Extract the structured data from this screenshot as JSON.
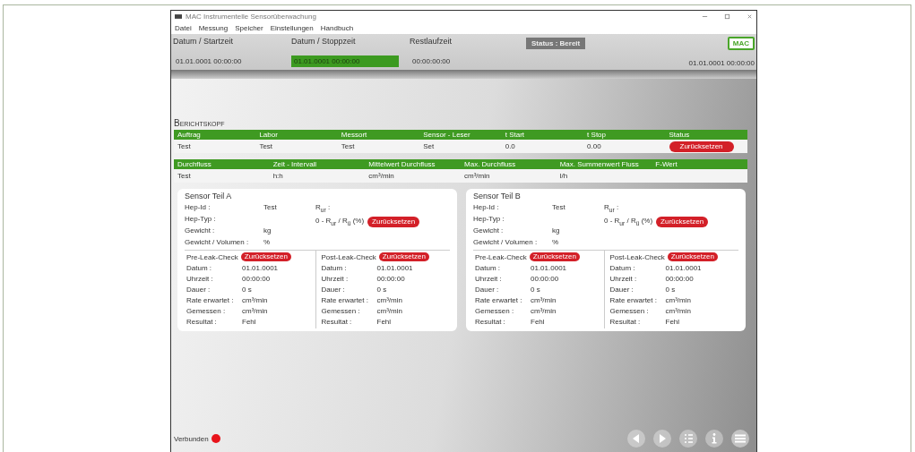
{
  "window": {
    "title": "MAC Instrumentelle Sensorüberwachung"
  },
  "menu": [
    "Datei",
    "Messung",
    "Speicher",
    "Einstellungen",
    "Handbuch"
  ],
  "header": {
    "fields": [
      {
        "label": "Datum / Startzeit",
        "value": "01.01.0001 00:00:00",
        "highlight": false
      },
      {
        "label": "Datum / Stoppzeit",
        "value": "01.01.0001 00:00:00",
        "highlight": true
      },
      {
        "label": "Restlaufzeit",
        "value": "00:00:00:00",
        "highlight": false
      }
    ],
    "status": "Status : Bereit",
    "logo": "MAC",
    "clock": "01.01.0001 00:00:00"
  },
  "report": {
    "title": "Berichtskopf",
    "tables": [
      {
        "columns": [
          "Auftrag",
          "Labor",
          "Messort",
          "Sensor - Leser",
          "t Start",
          "t Stop",
          "Status"
        ],
        "row": [
          "Test",
          "Test",
          "Test",
          "Set",
          "0.0",
          "0.00"
        ],
        "button": "Zurücksetzen"
      },
      {
        "columns": [
          "Durchfluss",
          "Zeit - Intervall",
          "Mittelwert Durchfluss",
          "Max. Durchfluss",
          "Max. Summenwert Fluss",
          "F-Wert"
        ],
        "row": [
          "Test",
          "h:h",
          "cm³/min",
          "cm³/min",
          "l/h"
        ]
      }
    ]
  },
  "sensors": [
    {
      "title": "Sensor Teil A",
      "fields": [
        {
          "label": "Hep-Id :",
          "value": "Test"
        },
        {
          "label": "Hep-Typ :"
        },
        {
          "label": "Gewicht :",
          "value": "kg"
        },
        {
          "label": "Gewicht / Volumen :",
          "value": "%"
        }
      ],
      "r_label": "R$_{ur}$ :",
      "formula": "0 - R$_{ur}$ / R$_{ü}$ (%)",
      "button": "Zurücksetzen",
      "checks": [
        {
          "label": "Pre-Leak-Check",
          "button": "Zurücksetzen",
          "rows": [
            {
              "label": "Datum :",
              "value": "01.01.0001"
            },
            {
              "label": "Uhrzeit :",
              "value": "00:00:00"
            },
            {
              "label": "Dauer :",
              "value": "0 s"
            },
            {
              "label": "Rate erwartet :",
              "value": "cm³/min"
            },
            {
              "label": "Gemessen :",
              "value": "cm³/min"
            },
            {
              "label": "Resultat :",
              "value": "Fehl"
            }
          ]
        },
        {
          "label": "Post-Leak-Check",
          "button": "Zurücksetzen",
          "rows": [
            {
              "label": "Datum :",
              "value": "01.01.0001"
            },
            {
              "label": "Uhrzeit :",
              "value": "00:00:00"
            },
            {
              "label": "Dauer :",
              "value": "0 s"
            },
            {
              "label": "Rate erwartet :",
              "value": "cm³/min"
            },
            {
              "label": "Gemessen :",
              "value": "cm³/min"
            },
            {
              "label": "Resultat :",
              "value": "Fehl"
            }
          ]
        }
      ]
    },
    {
      "title": "Sensor Teil B",
      "fields": [
        {
          "label": "Hep-Id :",
          "value": "Test"
        },
        {
          "label": "Hep-Typ :"
        },
        {
          "label": "Gewicht :",
          "value": "kg"
        },
        {
          "label": "Gewicht / Volumen :",
          "value": "%"
        }
      ],
      "r_label": "R$_{ur}$ :",
      "formula": "0 - R$_{ur}$ / R$_{ü}$ (%)",
      "button": "Zurücksetzen",
      "checks": [
        {
          "label": "Pre-Leak-Check",
          "button": "Zurücksetzen",
          "rows": [
            {
              "label": "Datum :",
              "value": "01.01.0001"
            },
            {
              "label": "Uhrzeit :",
              "value": "00:00:00"
            },
            {
              "label": "Dauer :",
              "value": "0 s"
            },
            {
              "label": "Rate erwartet :",
              "value": "cm³/min"
            },
            {
              "label": "Gemessen :",
              "value": "cm³/min"
            },
            {
              "label": "Resultat :",
              "value": "Fehl"
            }
          ]
        },
        {
          "label": "Post-Leak-Check",
          "button": "Zurücksetzen",
          "rows": [
            {
              "label": "Datum :",
              "value": "01.01.0001"
            },
            {
              "label": "Uhrzeit :",
              "value": "00:00:00"
            },
            {
              "label": "Dauer :",
              "value": "0 s"
            },
            {
              "label": "Rate erwartet :",
              "value": "cm³/min"
            },
            {
              "label": "Gemessen :",
              "value": "cm³/min"
            },
            {
              "label": "Resultat :",
              "value": "Fehl"
            }
          ]
        }
      ]
    }
  ],
  "footer": {
    "connection": "Verbunden",
    "color": "#e8141b",
    "nav": [
      {
        "kind": "prev"
      },
      {
        "kind": "next"
      },
      {
        "kind": "list"
      },
      {
        "kind": "info"
      },
      {
        "kind": "menu"
      }
    ]
  }
}
